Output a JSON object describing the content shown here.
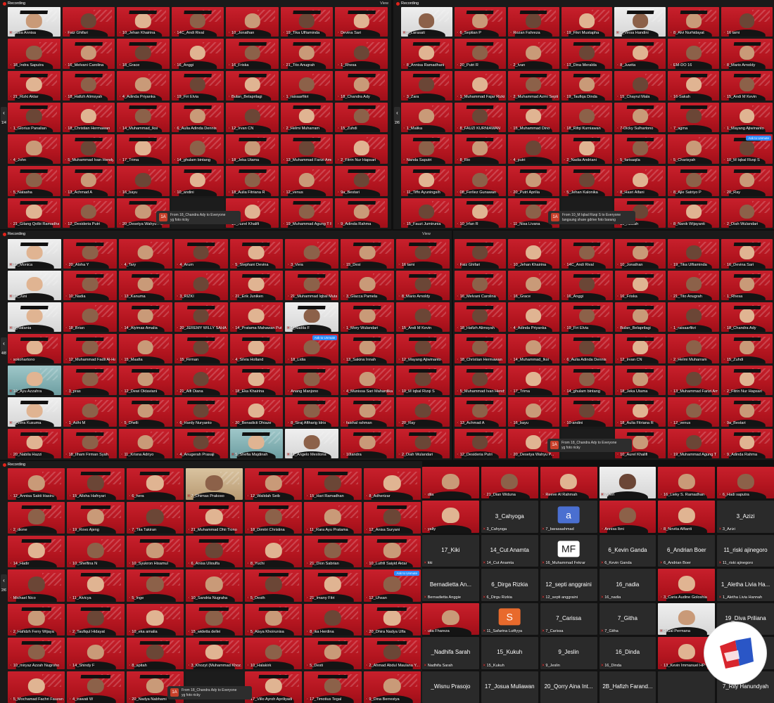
{
  "meeting": {
    "recording_label": "Recording",
    "view_label": "View"
  },
  "panels": [
    {
      "id": "p1",
      "page": "1/4",
      "chat": {
        "avatar": "1A",
        "line1": "From 18_Chandra Ady to Everyone",
        "line2": "yg foto ricky"
      },
      "tiles": [
        "Salsa Annisa",
        "Faiz Ghifari",
        "10_Jehan Khairina",
        "14C_Andi Rival",
        "10_Jonathan",
        "19_Tika Ulfiaminda",
        "Devina Sari",
        "18_Indra Saputra",
        "16_Melvani Carolina",
        "18_Grace",
        "16_Anggi",
        "16_Friska",
        "21_Tito Anugrah",
        "1_Rhesa",
        "21_Rizki Aktar",
        "18_Hafizh Alimsyah",
        "4_Adinda Priyanka",
        "19_Firi Elvia",
        "Bulan_Belaprilagi",
        "1_raisaarfikri",
        "18_Chandra Ady",
        "1_Glorius Panalian",
        "18_Christian Hermawan",
        "14_Muhammad_Iksi",
        "6_Aulia Adinda Dennis",
        "12_Irvan CN",
        "2_Helmi Muharram",
        "15_Zuhdi",
        "4_John",
        "5_Muhammad Ivan Hendy S...",
        "17_Trima",
        "14_ghulam bintang",
        "18_Jeka Utama",
        "13_Muhammad Farizi Amra...",
        "2_Fitrin Nur Hapsari",
        "5_Natasha",
        "13_Achmad A",
        "16_bayu",
        "10_andini",
        "18_Aulia Fitriana R",
        "12_venus",
        "9a_Bestari",
        "21_Gilang Qolbi Ramadhan",
        "12_Desideria Putri",
        "20_Desetya Wahyu P...",
        "",
        "10_Aurel Khalifi",
        "19_Muhammad Agung T R",
        "9_Adinda Rahma"
      ]
    },
    {
      "id": "p2",
      "page": "2/6",
      "unmute": "Ask to Unmute",
      "chat": {
        "avatar": "1A",
        "line1": "From 10_M Iqbal Rizqi S to Everyone",
        "line2": "langsung share gdrive foto barang"
      },
      "tiles": [
        "2_Larasati",
        "6_Septian P",
        "Rozan Fahreza",
        "19_Fikri Mustapha",
        "1_Vinsa Handini",
        "8_Alvi Nurhidayat",
        "16 tami",
        "8_Annisa Ramadhani",
        "20_Putri R",
        "2_Ivan",
        "13_Dina Meralda",
        "8_Juwita",
        "EM-DO 16",
        "8_Mario Arnoldy",
        "3_Zara",
        "1_Muhammad Fajar Rizki",
        "2_Muhammad Azmi Septian",
        "19_Taufiqa Dinda",
        "15_Chayrul Mala",
        "16-Sakah",
        "15_Andi M Kevin",
        "1_Malika",
        "8_FAUZI KURNIAWAN",
        "15_Muhammad Dino",
        "18_Rifqi Kurniawan",
        "7-Dicky Sulhartono",
        "7_agma",
        "1_Mayang Ajiwinanto",
        "Nanda Saputri",
        "8_Rio",
        "4_putri",
        "2_Nadia Andriani",
        "5_farisaqila",
        "5_Charisyah",
        "10_M Iqbal Rizqi S",
        "11_Tiffo Ayuningsih",
        "08_Ferliez Gunawan",
        "20_Putri Aprilia",
        "5_Jehan Kalonika",
        "8_Hasri Aifani",
        "8_Ajie Satriyo P",
        "20_Ray",
        "15_Fauzi Jumirunia",
        "10_Irfan R",
        "11_Nisa Livana",
        "",
        "10_Azizah",
        "8_Nanik Wijayanti",
        "2_Diah Wulandari"
      ]
    },
    {
      "id": "p3",
      "page": "4/8",
      "unmute": "Ask to Unmute",
      "tiles": [
        "12_Monica",
        "20_Aloha Y",
        "4_Tary",
        "4_Arum",
        "5_Stephani Devina",
        "3_Vera",
        "15_Desi",
        "16 tami",
        "16_Juni",
        "10_Nadia",
        "13_Kanuma",
        "3_RIZKI",
        "21_Erik Juniken",
        "21_Muhammad Iqbal Mutaqin",
        "3_Glacca Pamela",
        "8_Mario Arnoldy",
        "8_Natania",
        "18_Brian",
        "14_Alyimas Amalia",
        "20_JEREMY WILLY SAHALA",
        "14_Pratama Mahawan Putra",
        "1_Nadila F",
        "1_Mory Wulandari",
        "15_Andi M Kevin",
        "sokohartono",
        "12_Muhammad Fadli Al-Ha...",
        "15_Maafia",
        "15_Firman",
        "4_Silvia Holland",
        "18_Lidia",
        "13_Sakina Innah",
        "12_Mayang Ajiwinanto",
        "10_Ayu Azzahra",
        "3_pras",
        "12_Dewi Oktaviani",
        "21_Alfi Diana",
        "18_Eka Khairina",
        "Anang Manjono",
        "4_Munissa Sari Mahardika",
        "10_M Iqbal Rizqi S",
        "5_Wira Kusuma",
        "1_Adhi M",
        "5_Dhelli",
        "6_Hardy Nuryanto",
        "20_Benadicti Dhiaze",
        "8_Siraj Aftharig Idris",
        "faishal rahman",
        "20_Ray",
        "20_Nabila Hazzi",
        "18_Ilham Firman Syah",
        "11_Krisna Adriyo",
        "4_Anugerah Prasaji",
        "5_Shefia Majdinah",
        "11_Angelo Mexitona",
        "10landra",
        "2_Diah Wulandari"
      ]
    },
    {
      "id": "p4",
      "chat": {
        "avatar": "1A",
        "line1": "From 18_Chandra Ady to Everyone",
        "line2": "yg foto ricky"
      },
      "tiles": [
        "Faiz Ghifari",
        "10_Jehan Khairina",
        "14C_Andi Rival",
        "10_Jonathan",
        "19_Tika Ulfiaminda",
        "16_Devina Sari",
        "16_Melvani Carolina",
        "16_Grace",
        "16_Anggi",
        "16_Friska",
        "21_Tito Anugrah",
        "1_Rhesa",
        "18_Hafizh Alimsyah",
        "4_Adinda Priyanka",
        "19_Firi Elvia",
        "Bulan_Belaprilagi",
        "1_raisaarfikri",
        "18_Chandra Ady",
        "18_Christian Hermawan",
        "14_Muhammad_Iksi",
        "6_Aulia Adinda Dennis",
        "12_Irvan CN",
        "2_Helmi Muharram",
        "15_Zuhdi",
        "5_Muhammad Ivan Hendy S...",
        "17_Trima",
        "14_ghulam bintang",
        "18_Jeka Utama",
        "13_Muhammad Farizi Amra...",
        "2_Fitrin Nur Hapsari",
        "13_Achmad A",
        "16_bayu",
        "10-andini",
        "18_Aulia Fitriana R",
        "12_venus",
        "9a_Bestari",
        "12_Desideria Putri",
        "20_Desetya Wahyu P...",
        "",
        "10_Aurel Khalifi",
        "19_Muhammad Agung T R",
        "9_Adinda Rahma"
      ]
    },
    {
      "id": "p5",
      "page": "2/6",
      "unmute": "Ask to Unmute",
      "chat": {
        "avatar": "1A",
        "line1": "From 18_Chandra Ady to Everyone",
        "line2": "yg foto ricky"
      },
      "tiles": [
        "12_Annisa Sakti Hasiru",
        "15_Allsha Hafnyari",
        "6_hera",
        "7_Dhimas Prakoso",
        "12_Walidah Seib",
        "15_Hari Ramadhan",
        "8_Adherizar",
        "2_dione",
        "19_Rovo Ajeng",
        "7_Tita Takiran",
        "21_Muhammad Dhii Tiono",
        "18_Dimitri Christina",
        "11_Rara Ayu Pratama",
        "12_Anisa Suryani",
        "14_Hadir",
        "10_Shelfina N",
        "10_Syukron Hisamul",
        "6_Anisa Ulioulfa",
        "8_Yuchi",
        "21_Dion Sabrian",
        "10_Luthfi Saiyid Aktar",
        "Michael Nico",
        "11_Alvicya",
        "5_Inge",
        "10_Sandria Nugraha",
        "5_Desth",
        "21_Imany Fitri",
        "12_Uhsan",
        "2_Hafidzh Ferry Wijaya",
        "2_Taufiqul Hidayat",
        "10_eka amalia",
        "15_widetta dellei",
        "5_Alsya Khoirunisa",
        "8_ika Herdina",
        "20_Dhira Nadya Ulfa",
        "10_miryaz Azzah Nugroho",
        "14_Shindy F",
        "8_apitah",
        "3_Khozyt (Muhammad Khoz...",
        "10_Halakirk",
        "5_Desti",
        "2_Ahmad Abdul Maulana Y...",
        "5_Mochamad Fachri Fauzan",
        "4_irawati W",
        "20_Nadya Nabhami",
        "",
        "17_Villo Ayroh Apriliyadi",
        "17_Timotius Tegal",
        "9_Dina Berrestya"
      ]
    }
  ],
  "side_panel": {
    "rows": [
      {
        "big": "",
        "small": "dila"
      },
      {
        "big": "",
        "small": "21_Dian Widuna"
      },
      {
        "big": "",
        "small": "Reeve Al Rahmah"
      },
      {
        "big": "",
        "small": "7_ferl"
      },
      {
        "big": "",
        "small": "16_Lieky S. Ramadhan"
      },
      {
        "big": "",
        "small": "6_Hadi saputra"
      },
      {
        "big": "",
        "small": "yalty"
      },
      {
        "big": "3_Cahyoga",
        "small": "3_Cahyoga"
      },
      {
        "big": "a",
        "small": "7_barasaahmad"
      },
      {
        "big": "",
        "small": "Annisa Ibni"
      },
      {
        "big": "",
        "small": "8_Novita Alfianti"
      },
      {
        "big": "3_Azizi",
        "small": "3_Azizi"
      },
      {
        "big": "17_Kiki",
        "small": "kki"
      },
      {
        "big": "14_Cut Anamta",
        "small": "14_Cut Anamta"
      },
      {
        "big": "MF",
        "small": "16_Muhammad Fekrar"
      },
      {
        "big": "6_Kevin Ganda",
        "small": "6_Kevin Ganda"
      },
      {
        "big": "6_Andrian Boer",
        "small": "6_Andrian Boer"
      },
      {
        "big": "11_riski ajinegoro",
        "small": "11_riski ajinegoro"
      },
      {
        "big": "Bernadietta An...",
        "small": "Bernadietta Anggie"
      },
      {
        "big": "6_Dirga Rizkia",
        "small": "6_Dirgu Rizkia"
      },
      {
        "big": "12_septi anggraini",
        "small": "12_septi anggraini"
      },
      {
        "big": "16_nadia",
        "small": "16_nadia"
      },
      {
        "big": "",
        "small": "3_Caria Audine Goloshia"
      },
      {
        "big": "1_Aletha Livia Ha...",
        "small": "1_Aletha Livia Hannah"
      },
      {
        "big": "",
        "small": "utia Fhareza"
      },
      {
        "big": "S",
        "small": "11_Safarina Lutfiyya"
      },
      {
        "big": "7_Carissa",
        "small": "7_Carissa"
      },
      {
        "big": "7_Githa",
        "small": "7_Githa"
      },
      {
        "big": "",
        "small": "9-Gal Permana"
      },
      {
        "big": "19_Diva Priliana",
        "small": ""
      },
      {
        "big": "_Nadhifa Sarah",
        "small": "Nadhifa Sarah"
      },
      {
        "big": "15_Kukuh",
        "small": "15_Kukuh"
      },
      {
        "big": "9_Jeslin",
        "small": "9_Jeslin"
      },
      {
        "big": "16_Dinda",
        "small": "16_Dinda"
      },
      {
        "big": "",
        "small": "13_Kevin Immanuel HP"
      },
      {
        "big": "",
        "small": ""
      },
      {
        "big": "_Wisnu Prasojo",
        "small": ""
      },
      {
        "big": "17_Josua Muliawan",
        "small": ""
      },
      {
        "big": "20_Qorry Aina Int...",
        "small": ""
      },
      {
        "big": "2B_Hafizh Farand...",
        "small": ""
      },
      {
        "big": "",
        "small": ""
      },
      {
        "big": "7_Rily Hanundyah",
        "small": ""
      }
    ]
  },
  "colors": {
    "brand_red": "#c8202c",
    "mic_off": "#e23b3b",
    "unmute_blue": "#2d8cff"
  }
}
